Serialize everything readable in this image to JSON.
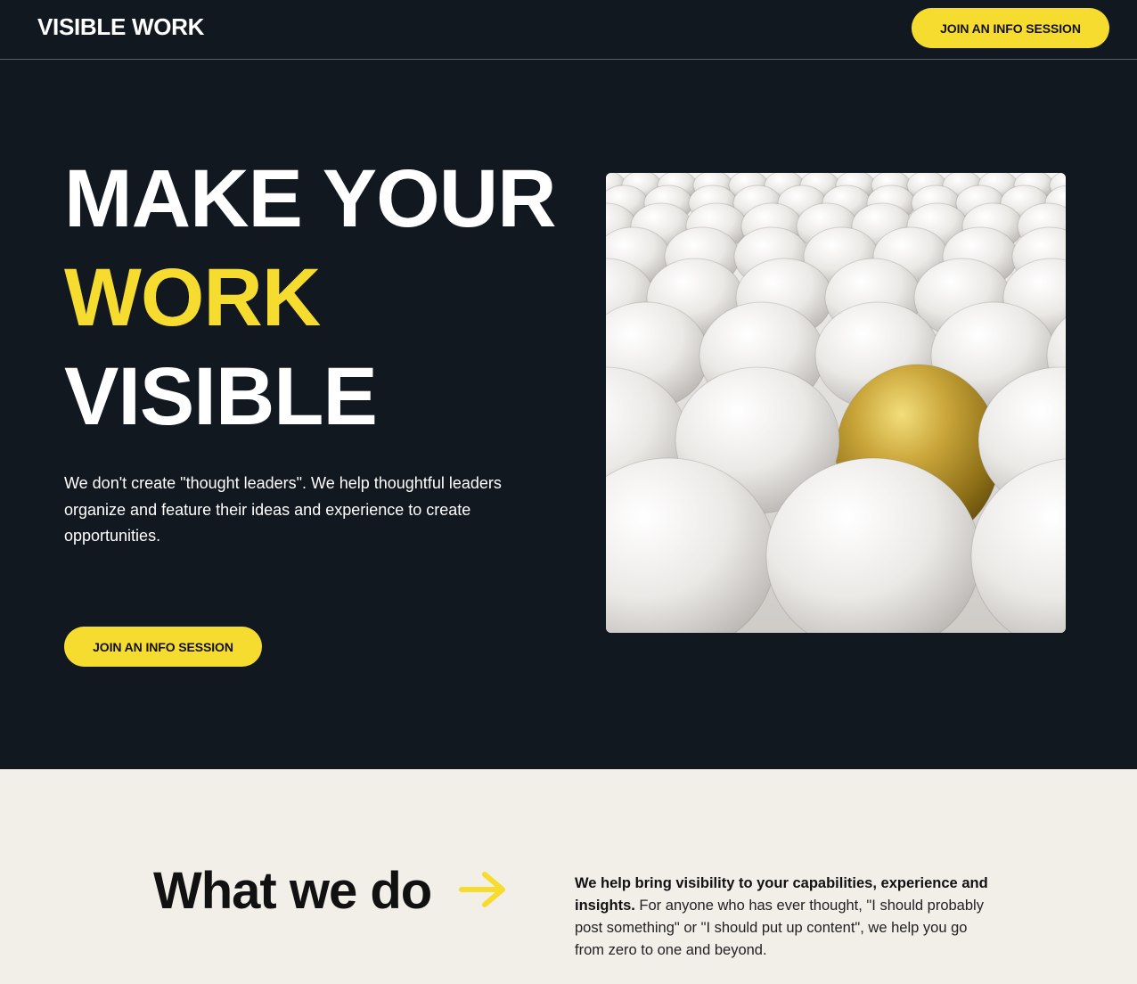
{
  "header": {
    "brand": "VISIBLE WORK",
    "cta_label": "JOIN AN INFO SESSION"
  },
  "hero": {
    "headline_lines": [
      "MAKE YOUR",
      "WORK",
      "VISIBLE"
    ],
    "description": "We don't create \"thought leaders\". We help thoughtful leaders organize and feature their ideas and experience to create opportunities.",
    "cta_label": "JOIN AN INFO SESSION",
    "image_icon": "golden-egg-image"
  },
  "what_we_do": {
    "title": "What we do",
    "arrow_icon": "arrow-right-icon",
    "lead_bold": "We help bring visibility to your capabilities, experience and insights.",
    "body": " For anyone who has ever thought, \"I should probably post something\" or \"I should put up content\", we help you go from zero to one and beyond."
  },
  "colors": {
    "background_dark": "#111820",
    "accent_yellow": "#f6dc2f",
    "section_light": "#f2efe9"
  }
}
